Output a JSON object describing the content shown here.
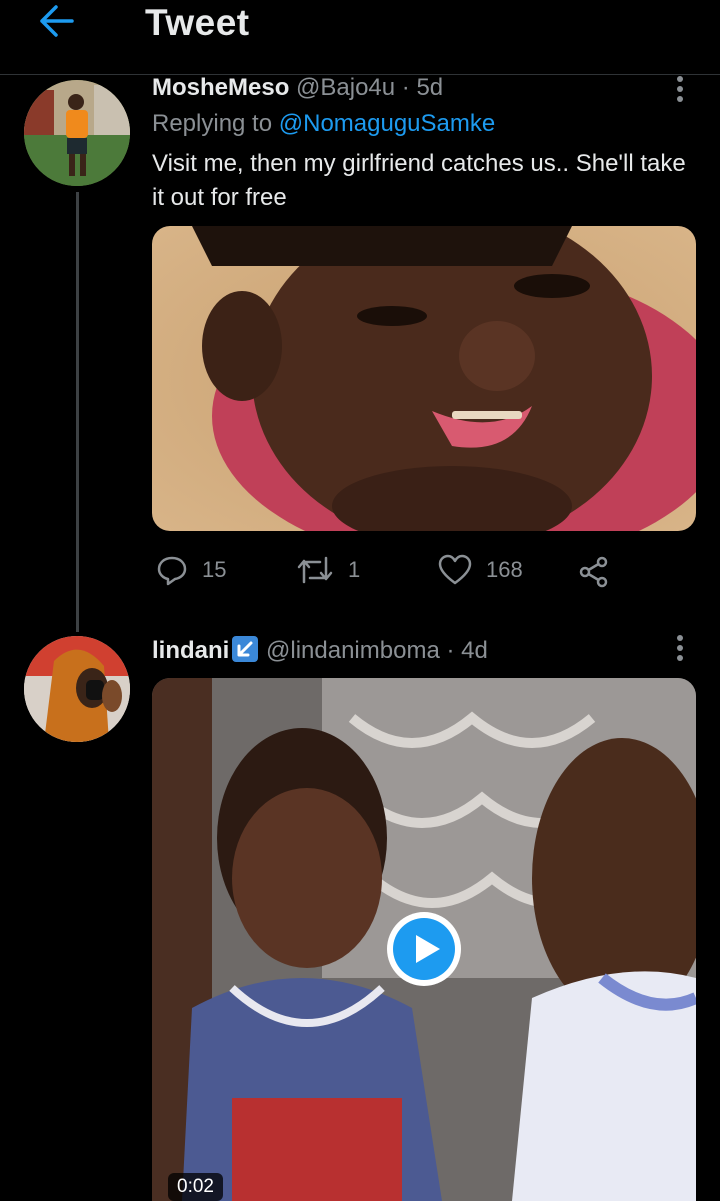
{
  "header": {
    "title": "Tweet",
    "back_icon": "arrow-left-icon"
  },
  "tweets": [
    {
      "name": "MosheMeso",
      "handle_time": "@Bajo4u · 5d",
      "replying_prefix": "Replying to",
      "replying_to": "@NomaguguSamke",
      "text": "Visit me, then my girlfriend catches us.. She'll take it out for free",
      "actions": {
        "replies": "15",
        "retweets": "1",
        "likes": "168"
      }
    },
    {
      "name": "lindani",
      "handle_time": "@lindanimboma · 4d",
      "video_duration": "0:02"
    }
  ],
  "colors": {
    "accent": "#1d9bf0",
    "background": "#000000",
    "secondary_text": "#8b9095"
  }
}
